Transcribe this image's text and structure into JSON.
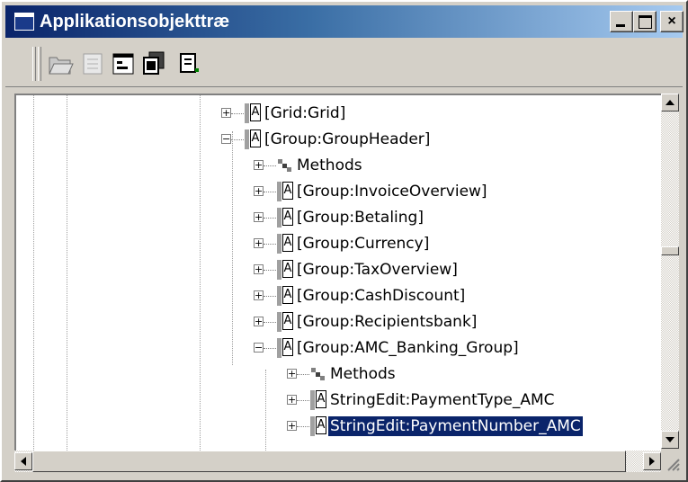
{
  "window": {
    "title": "Applikationsobjekttræ",
    "close_glyph": "×",
    "title_gradient": [
      "#0a246a",
      "#a6caf0"
    ]
  },
  "toolbar": {
    "icons": [
      "open-folder-icon",
      "new-item-icon",
      "properties-icon",
      "copy-icon",
      "paste-icon"
    ]
  },
  "tree": {
    "items": [
      {
        "label": "[Grid:Grid]",
        "expander": "+",
        "icon": "object-icon"
      },
      {
        "label": "[Group:GroupHeader]",
        "expander": "−",
        "icon": "object-icon"
      },
      {
        "label": "Methods",
        "expander": "+",
        "icon": "methods-icon"
      },
      {
        "label": "[Group:InvoiceOverview]",
        "expander": "+",
        "icon": "object-icon"
      },
      {
        "label": "[Group:Betaling]",
        "expander": "+",
        "icon": "object-icon"
      },
      {
        "label": "[Group:Currency]",
        "expander": "+",
        "icon": "object-icon"
      },
      {
        "label": "[Group:TaxOverview]",
        "expander": "+",
        "icon": "object-icon"
      },
      {
        "label": "[Group:CashDiscount]",
        "expander": "+",
        "icon": "object-icon"
      },
      {
        "label": "[Group:Recipientsbank]",
        "expander": "+",
        "icon": "object-icon"
      },
      {
        "label": "[Group:AMC_Banking_Group]",
        "expander": "−",
        "icon": "object-icon"
      },
      {
        "label": "Methods",
        "expander": "+",
        "icon": "methods-icon"
      },
      {
        "label": "StringEdit:PaymentType_AMC",
        "expander": "+",
        "icon": "object-icon"
      },
      {
        "label": "StringEdit:PaymentNumber_AMC",
        "expander": "+",
        "icon": "object-icon",
        "selected": true
      }
    ],
    "icon_glyph": "A",
    "selection_color": "#0a246a"
  },
  "scrollbars": {
    "up": "▲",
    "down": "▼",
    "left": "◀",
    "right": "▶"
  }
}
